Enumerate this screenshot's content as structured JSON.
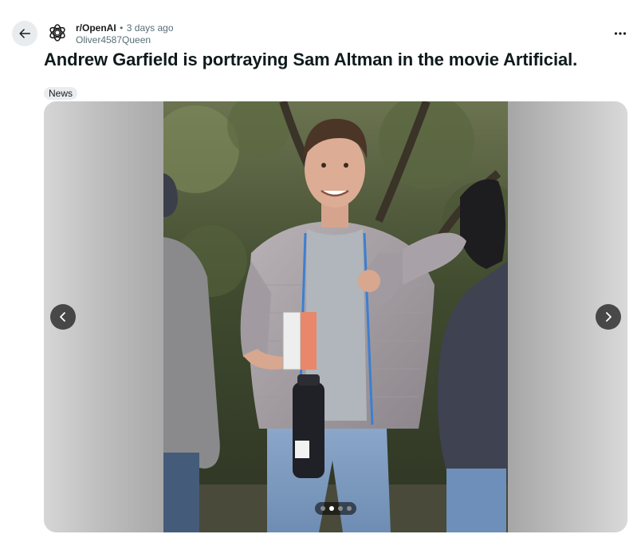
{
  "post": {
    "subreddit": "r/OpenAI",
    "separator": "•",
    "time": "3 days ago",
    "author": "Oliver4587Queen",
    "title": "Andrew Garfield is portraying Sam Altman in the movie Artificial.",
    "flair": "News"
  },
  "icons": {
    "back": "arrow-left-icon",
    "avatar": "openai-logo-icon",
    "more": "ellipsis-icon",
    "prev": "chevron-left-icon",
    "next": "chevron-right-icon"
  },
  "gallery": {
    "total_images": 4,
    "current_index": 2
  },
  "colors": {
    "meta_text": "#576f76",
    "flair_bg": "#eaedef",
    "back_bg": "#e9ecef"
  }
}
